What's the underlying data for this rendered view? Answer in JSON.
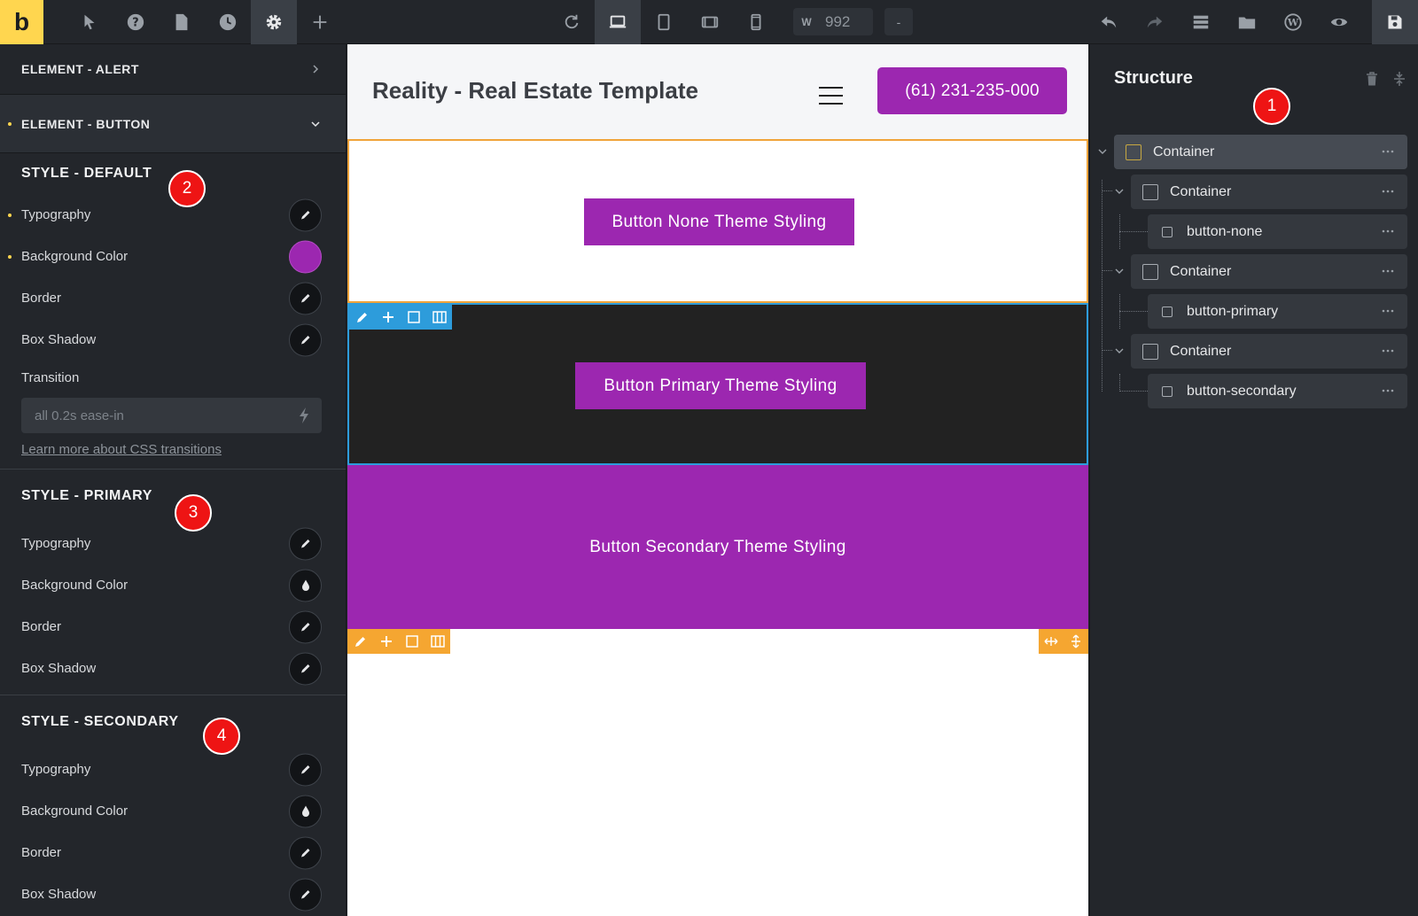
{
  "app": {
    "logo": "b"
  },
  "toolbar": {
    "left_icons": [
      "pointer-icon",
      "help-icon",
      "page-icon",
      "history-icon",
      "settings-icon",
      "add-icon"
    ],
    "center_icons": [
      "refresh-icon",
      "laptop-icon",
      "tablet-icon",
      "tablet-landscape-icon",
      "mobile-icon"
    ],
    "width_label": "W",
    "width_value": "992",
    "dash": "-",
    "right_icons": [
      "undo-icon",
      "redo-icon",
      "stack-icon",
      "folder-icon",
      "wordpress-icon",
      "eye-icon",
      "save-icon"
    ]
  },
  "left_panel": {
    "accordion_alert": "ELEMENT - ALERT",
    "accordion_button": "ELEMENT - BUTTON",
    "style_default": {
      "title": "STYLE - DEFAULT",
      "typography": "Typography",
      "background_color": "Background Color",
      "border": "Border",
      "box_shadow": "Box Shadow",
      "transition": "Transition",
      "transition_placeholder": "all 0.2s ease-in",
      "learn_more": "Learn more about CSS transitions",
      "bg_color_value": "#9c27b0"
    },
    "style_primary": {
      "title": "STYLE - PRIMARY",
      "typography": "Typography",
      "background_color": "Background Color",
      "border": "Border",
      "box_shadow": "Box Shadow"
    },
    "style_secondary": {
      "title": "STYLE - SECONDARY",
      "typography": "Typography",
      "background_color": "Background Color",
      "border": "Border",
      "box_shadow": "Box Shadow"
    }
  },
  "canvas": {
    "site_title": "Reality - Real Estate Template",
    "phone": "(61) 231-235-000",
    "btn_none": "Button None Theme Styling",
    "btn_primary": "Button Primary Theme Styling",
    "btn_secondary": "Button Secondary Theme Styling",
    "colors": {
      "accent": "#9c27b0",
      "dark": "#222222",
      "highlight_blue": "#2d9cdb",
      "highlight_orange": "#f5a631"
    }
  },
  "structure": {
    "title": "Structure",
    "nodes": [
      {
        "label": "Container"
      },
      {
        "label": "Container"
      },
      {
        "label": "button-none"
      },
      {
        "label": "Container"
      },
      {
        "label": "button-primary"
      },
      {
        "label": "Container"
      },
      {
        "label": "button-secondary"
      }
    ]
  },
  "badges": [
    "1",
    "2",
    "3",
    "4"
  ]
}
